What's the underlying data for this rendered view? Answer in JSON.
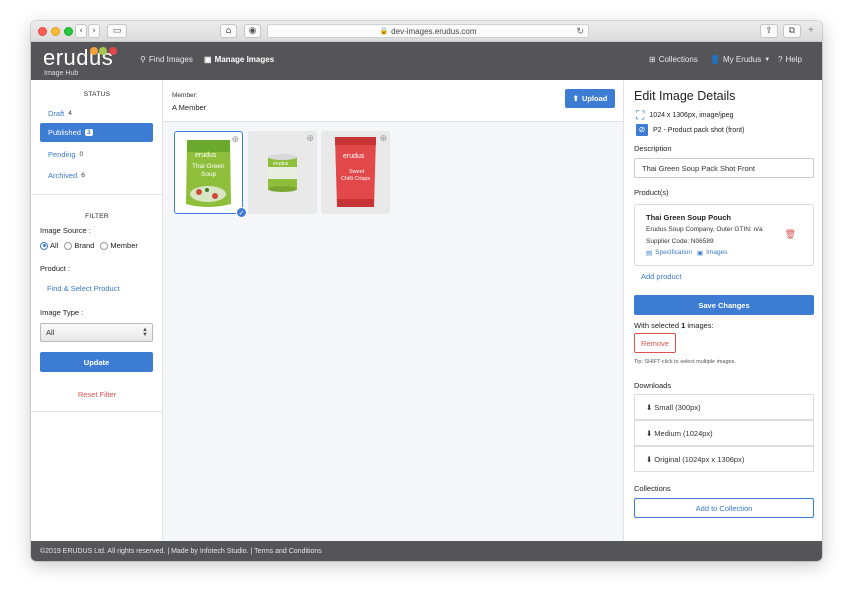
{
  "browser": {
    "url": "dev-images.erudus.com"
  },
  "nav": {
    "logo": "erudus",
    "logo_sub": "Image Hub",
    "find_images": "Find Images",
    "manage_images": "Manage Images",
    "collections": "Collections",
    "my_erudus": "My Erudus",
    "help": "Help"
  },
  "sidebar": {
    "status_title": "STATUS",
    "status_items": [
      {
        "label": "Draft",
        "count": "4"
      },
      {
        "label": "Published",
        "count": "3"
      },
      {
        "label": "Pending",
        "count": "0"
      },
      {
        "label": "Archived",
        "count": "6"
      }
    ],
    "filter_title": "FILTER",
    "image_source_label": "Image Source :",
    "radio_all": "All",
    "radio_brand": "Brand",
    "radio_member": "Member",
    "product_label": "Product :",
    "find_product": "Find & Select Product",
    "image_type_label": "Image Type :",
    "image_type_value": "All",
    "update": "Update",
    "reset": "Reset Filter"
  },
  "center": {
    "member_label": "Member:",
    "member_value": "A Member",
    "upload": "Upload",
    "thumbs": [
      {
        "brand": "erudus",
        "text1": "Thai Green",
        "text2": "Soup"
      },
      {
        "brand": "erudus",
        "text1": "",
        "text2": ""
      },
      {
        "brand": "erudus",
        "text1": "Sweet",
        "text2": "Chilli Crisps"
      }
    ]
  },
  "details": {
    "title": "Edit Image Details",
    "dims": "1024 x 1306px, image/jpeg",
    "type": "P2 - Product pack shot (front)",
    "description_label": "Description",
    "description_value": "Thai Green Soup Pack Shot Front",
    "products_label": "Product(s)",
    "product_name": "Thai Green Soup Pouch",
    "product_company": "Erudus Soup Company, Outer GTIN: n/a",
    "product_supplier": "Supplier Code: N06589",
    "specification": "Specification",
    "images": "Images",
    "add_product": "Add product",
    "save": "Save Changes",
    "with_selected_prefix": "With selected ",
    "with_selected_count": "1",
    "with_selected_suffix": " images:",
    "remove": "Remove",
    "tip": "Tip: SHIFT-click to select multiple images.",
    "downloads_label": "Downloads",
    "downloads": [
      "Small (300px)",
      "Medium (1024px)",
      "Original (1024px x 1306px)"
    ],
    "collections_label": "Collections",
    "add_collection": "Add to Collection"
  },
  "footer": {
    "text": "©2019 ERUDUS Ltd. All rights reserved. | Made by Infotech Studio. | Terms and Conditions"
  },
  "colors": {
    "primary": "#3c7cd2",
    "nav": "#555559",
    "danger": "#d9534f"
  }
}
